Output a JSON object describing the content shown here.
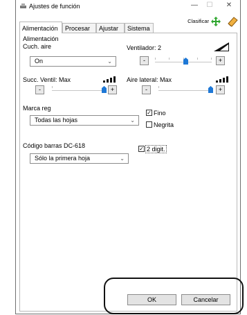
{
  "window": {
    "title": "Ajustes de función",
    "minimize_glyph": "—",
    "maximize_glyph": "☐",
    "close_glyph": "✕"
  },
  "tabs": [
    "Alimentación",
    "Procesar",
    "Ajustar",
    "Sistema"
  ],
  "clasificar": {
    "label": "Clasificar"
  },
  "group_title": "Alimentación",
  "cuch_aire": {
    "label": "Cuch. aire",
    "value": "On"
  },
  "ventilador": {
    "label": "Ventilador: 2",
    "minus": "-",
    "plus": "+",
    "level": 0.6
  },
  "succ_ventil": {
    "label": "Succ. Ventil: Max",
    "minus": "-",
    "plus": "+",
    "level": 1.0
  },
  "aire_lateral": {
    "label": "Aire lateral: Max",
    "minus": "-",
    "plus": "+",
    "level": 1.0
  },
  "marca_reg": {
    "label": "Marca reg",
    "value": "Todas las hojas",
    "fino_label": "Fino",
    "fino_checked": true,
    "negrita_label": "Negrita",
    "negrita_checked": false
  },
  "codigo_barras": {
    "label": "Código barras DC-618",
    "value": "Sólo la primera hoja",
    "digit_label": "2 digit.",
    "digit_checked": true
  },
  "buttons": {
    "ok": "OK",
    "cancel": "Cancelar"
  },
  "check_glyph": "✓",
  "icons": {
    "app": "scanner-icon",
    "clasificar": "sort-arrows-icon",
    "eraser": "eraser-icon"
  },
  "colors": {
    "thumb": "#1e78d6",
    "clasificar_icon": "#2fa62f"
  }
}
